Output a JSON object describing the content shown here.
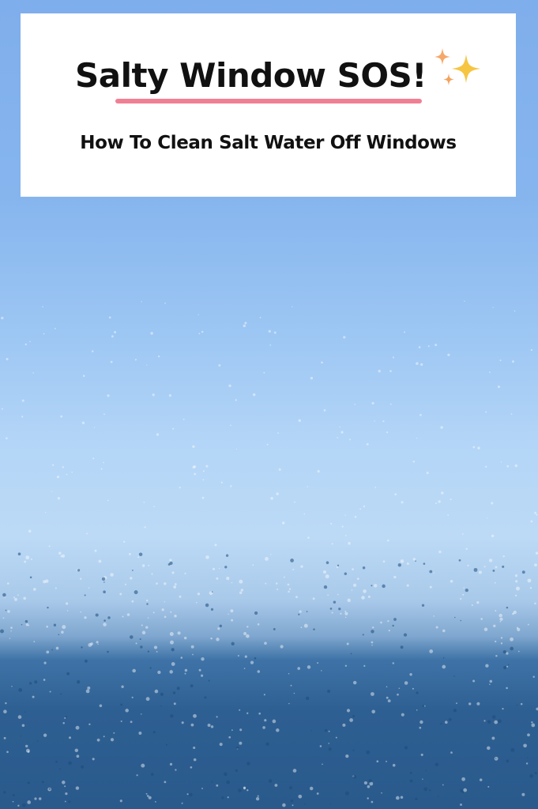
{
  "title_card": {
    "title": "Salty Window SOS!",
    "subtitle": "How To Clean Salt Water Off Windows",
    "accent_color": "#f17f93",
    "sparkle_icon": "sparkles-icon"
  },
  "background": {
    "description_icon": "wet-window-glass",
    "sky_color": "#7faeec",
    "water_color": "#2a5a8c"
  }
}
